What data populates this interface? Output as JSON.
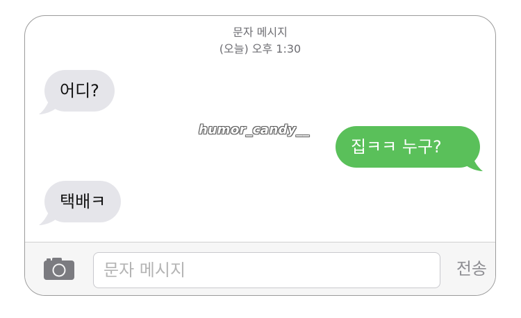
{
  "header": {
    "title": "문자 메시지",
    "timestamp": "(오늘) 오후 1:30"
  },
  "messages": [
    {
      "direction": "incoming",
      "text": "어디?"
    },
    {
      "direction": "outgoing",
      "text": "집ㅋㅋ 누구?"
    },
    {
      "direction": "incoming",
      "text": "택배ㅋ"
    }
  ],
  "watermark": "humor_candy__",
  "composer": {
    "camera_icon": "camera-icon",
    "placeholder": "문자 메시지",
    "value": "",
    "send_label": "전송"
  },
  "colors": {
    "incoming_bubble": "#e5e5ea",
    "outgoing_bubble": "#5ac05a",
    "header_text": "#6d6d72",
    "send_text": "#8e8e93"
  }
}
